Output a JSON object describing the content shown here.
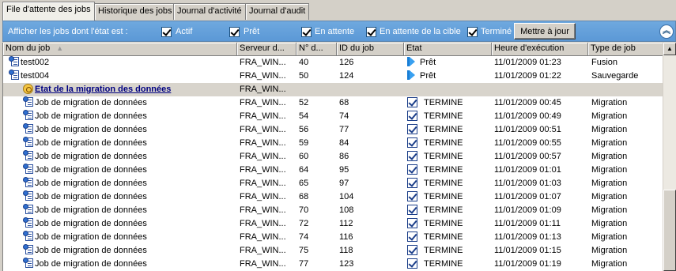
{
  "tabs": [
    {
      "label": "File d'attente des jobs",
      "active": true
    },
    {
      "label": "Historique des jobs",
      "active": false
    },
    {
      "label": "Journal d'activité",
      "active": false
    },
    {
      "label": "Journal d'audit",
      "active": false
    }
  ],
  "filter": {
    "label": "Afficher les jobs dont l'état est :",
    "options": [
      {
        "label": "Actif",
        "checked": true
      },
      {
        "label": "Prêt",
        "checked": true
      },
      {
        "label": "En attente",
        "checked": true
      },
      {
        "label": "En attente de la cible",
        "checked": true
      },
      {
        "label": "Terminé",
        "checked": true
      }
    ],
    "update_button": "Mettre à jour",
    "collapse_icon": "double-chevron-up-icon"
  },
  "columns": [
    "Nom du job",
    "Serveur d...",
    "N° d...",
    "ID du job",
    "Etat",
    "Heure d'exécution",
    "Type de job"
  ],
  "rows": [
    {
      "kind": "job",
      "name": "test002",
      "server": "FRA_WIN...",
      "num": "40",
      "id": "126",
      "state_icon": "ready",
      "state": "Prêt",
      "time": "11/01/2009  01:23",
      "type": "Fusion"
    },
    {
      "kind": "job",
      "name": "test004",
      "server": "FRA_WIN...",
      "num": "50",
      "id": "124",
      "state_icon": "ready",
      "state": "Prêt",
      "time": "11/01/2009  01:22",
      "type": "Sauvegarde"
    },
    {
      "kind": "group",
      "name": "Etat de la migration des données",
      "server": "FRA_WIN...",
      "num": "",
      "id": "",
      "state_icon": "",
      "state": "",
      "time": "",
      "type": ""
    },
    {
      "kind": "child",
      "name": "Job de migration de données",
      "server": "FRA_WIN...",
      "num": "52",
      "id": "68",
      "state_icon": "done",
      "state": "TERMINE",
      "time": "11/01/2009  00:45",
      "type": "Migration"
    },
    {
      "kind": "child",
      "name": "Job de migration de données",
      "server": "FRA_WIN...",
      "num": "54",
      "id": "74",
      "state_icon": "done",
      "state": "TERMINE",
      "time": "11/01/2009  00:49",
      "type": "Migration"
    },
    {
      "kind": "child",
      "name": "Job de migration de données",
      "server": "FRA_WIN...",
      "num": "56",
      "id": "77",
      "state_icon": "done",
      "state": "TERMINE",
      "time": "11/01/2009  00:51",
      "type": "Migration"
    },
    {
      "kind": "child",
      "name": "Job de migration de données",
      "server": "FRA_WIN...",
      "num": "59",
      "id": "84",
      "state_icon": "done",
      "state": "TERMINE",
      "time": "11/01/2009  00:55",
      "type": "Migration"
    },
    {
      "kind": "child",
      "name": "Job de migration de données",
      "server": "FRA_WIN...",
      "num": "60",
      "id": "86",
      "state_icon": "done",
      "state": "TERMINE",
      "time": "11/01/2009  00:57",
      "type": "Migration"
    },
    {
      "kind": "child",
      "name": "Job de migration de données",
      "server": "FRA_WIN...",
      "num": "64",
      "id": "95",
      "state_icon": "done",
      "state": "TERMINE",
      "time": "11/01/2009  01:01",
      "type": "Migration"
    },
    {
      "kind": "child",
      "name": "Job de migration de données",
      "server": "FRA_WIN...",
      "num": "65",
      "id": "97",
      "state_icon": "done",
      "state": "TERMINE",
      "time": "11/01/2009  01:03",
      "type": "Migration"
    },
    {
      "kind": "child",
      "name": "Job de migration de données",
      "server": "FRA_WIN...",
      "num": "68",
      "id": "104",
      "state_icon": "done",
      "state": "TERMINE",
      "time": "11/01/2009  01:07",
      "type": "Migration"
    },
    {
      "kind": "child",
      "name": "Job de migration de données",
      "server": "FRA_WIN...",
      "num": "70",
      "id": "108",
      "state_icon": "done",
      "state": "TERMINE",
      "time": "11/01/2009  01:09",
      "type": "Migration"
    },
    {
      "kind": "child",
      "name": "Job de migration de données",
      "server": "FRA_WIN...",
      "num": "72",
      "id": "112",
      "state_icon": "done",
      "state": "TERMINE",
      "time": "11/01/2009  01:11",
      "type": "Migration"
    },
    {
      "kind": "child",
      "name": "Job de migration de données",
      "server": "FRA_WIN...",
      "num": "74",
      "id": "116",
      "state_icon": "done",
      "state": "TERMINE",
      "time": "11/01/2009  01:13",
      "type": "Migration"
    },
    {
      "kind": "child",
      "name": "Job de migration de données",
      "server": "FRA_WIN...",
      "num": "75",
      "id": "118",
      "state_icon": "done",
      "state": "TERMINE",
      "time": "11/01/2009  01:15",
      "type": "Migration"
    },
    {
      "kind": "child",
      "name": "Job de migration de données",
      "server": "FRA_WIN...",
      "num": "77",
      "id": "123",
      "state_icon": "done",
      "state": "TERMINE",
      "time": "11/01/2009  01:19",
      "type": "Migration"
    }
  ]
}
